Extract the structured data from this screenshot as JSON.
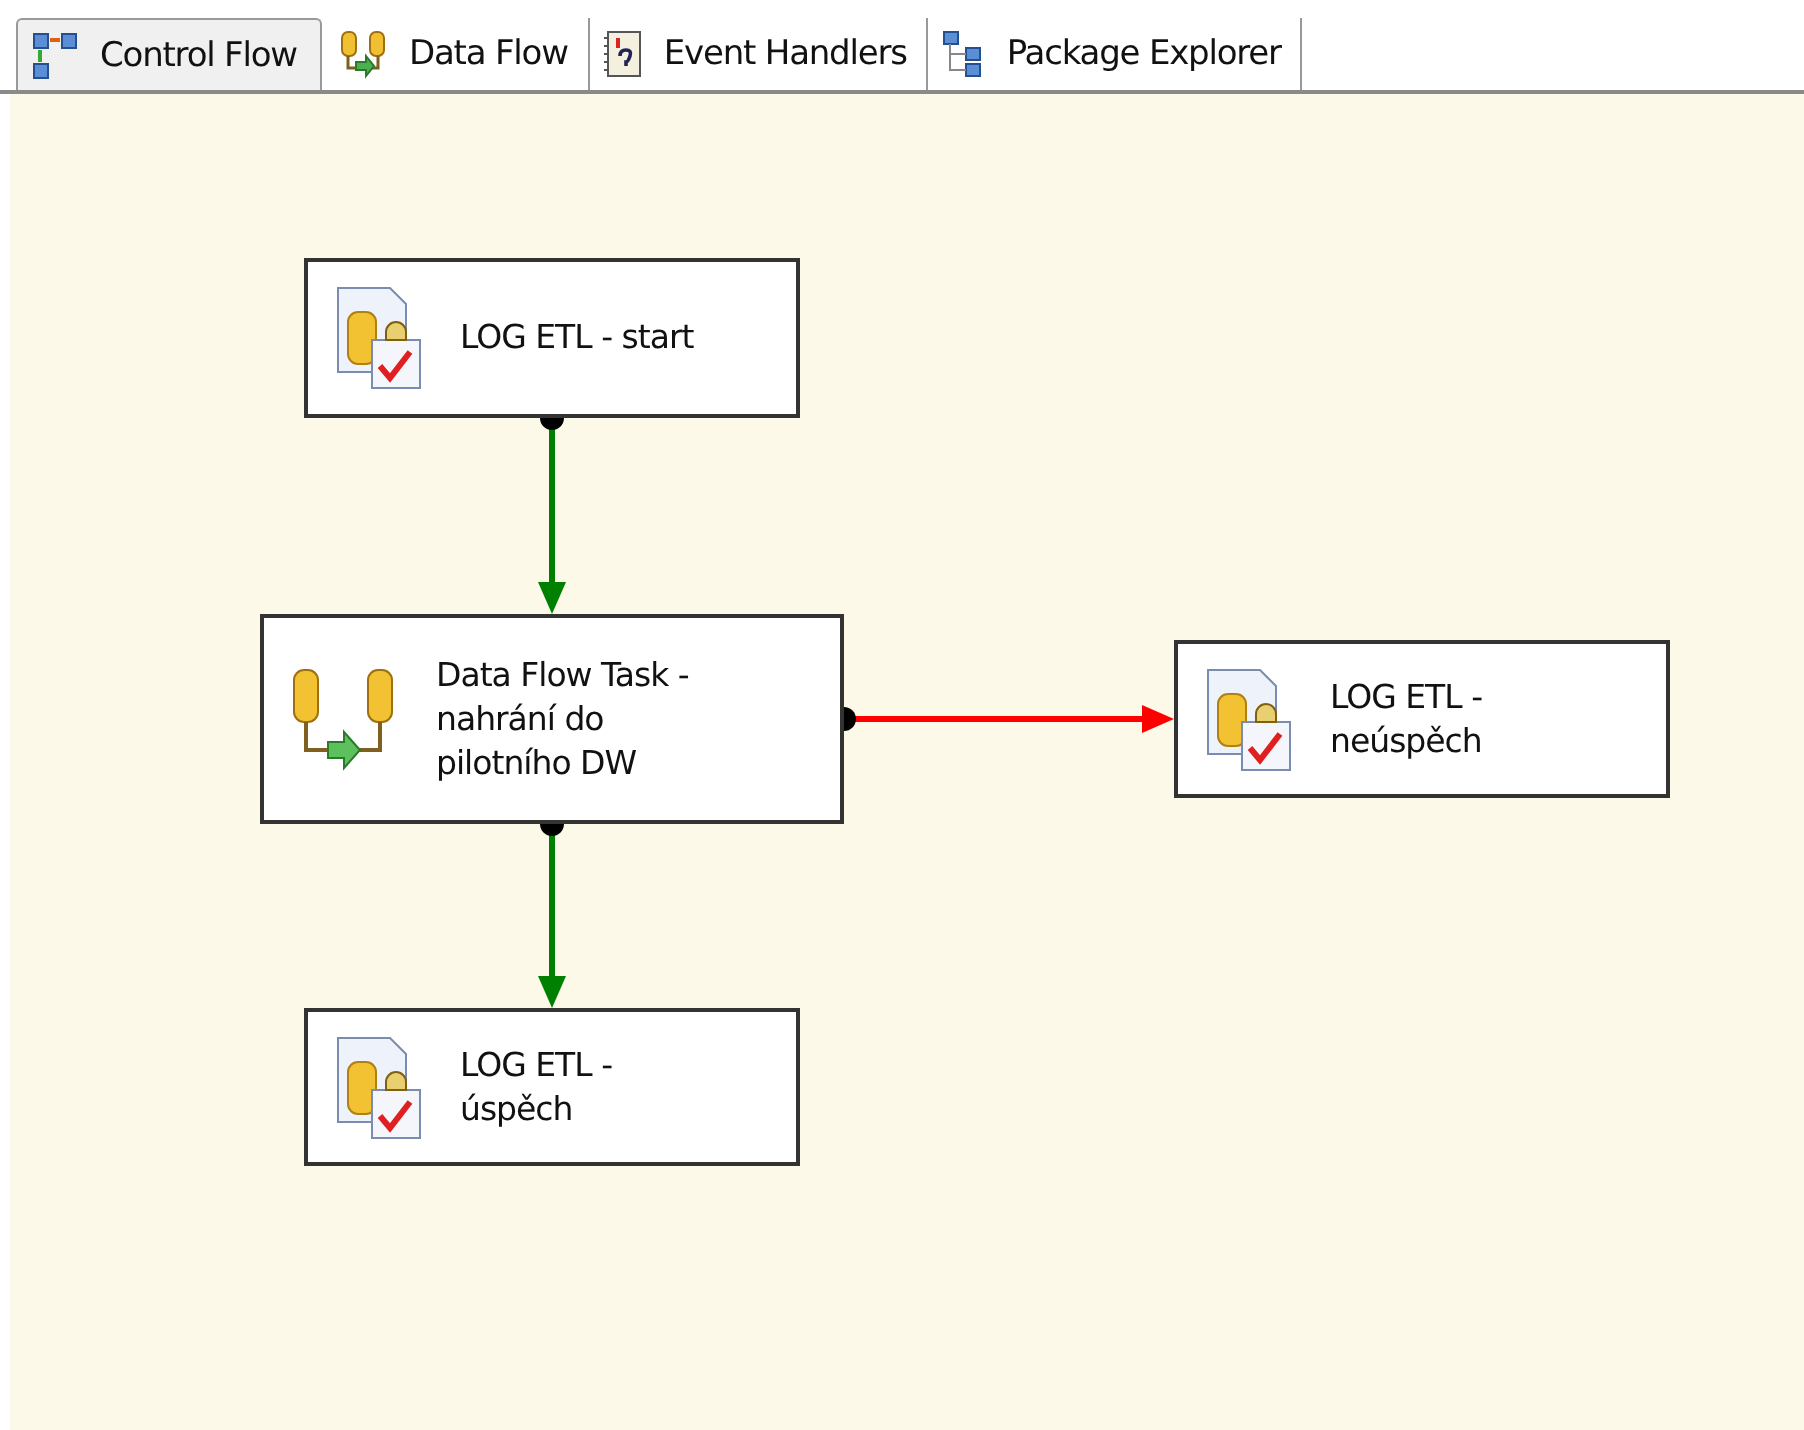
{
  "tabs": [
    {
      "label": "Control Flow",
      "selected": true
    },
    {
      "label": "Data Flow",
      "selected": false
    },
    {
      "label": "Event Handlers",
      "selected": false
    },
    {
      "label": "Package Explorer",
      "selected": false
    }
  ],
  "tasks": [
    {
      "kind": "sql",
      "label": "LOG ETL - start"
    },
    {
      "kind": "dataflow",
      "label": "Data Flow Task - nahrání do pilotního DW"
    },
    {
      "kind": "sql",
      "label": "LOG ETL - neúspěch"
    },
    {
      "kind": "sql",
      "label": "LOG ETL - úspěch"
    }
  ],
  "constraints": [
    {
      "color": "#008000"
    },
    {
      "color": "#ff0000"
    },
    {
      "color": "#008000"
    }
  ]
}
